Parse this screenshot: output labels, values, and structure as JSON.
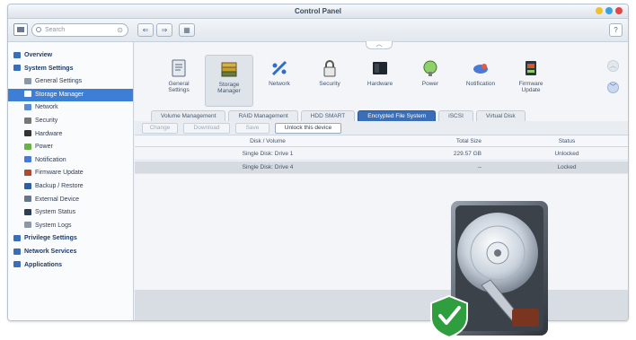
{
  "window": {
    "title": "Control Panel"
  },
  "toolbar": {
    "search_placeholder": "Search",
    "back": "⇐",
    "forward": "⇒",
    "grid": "▦",
    "help": "?"
  },
  "sidebar": {
    "items": [
      {
        "label": "Overview",
        "level": "top",
        "icon": "overview-icon",
        "color": "#3a6fb8"
      },
      {
        "label": "System Settings",
        "level": "top",
        "icon": "gear-icon",
        "color": "#3a6fb8"
      },
      {
        "label": "General Settings",
        "level": "sub",
        "icon": "general-settings-icon",
        "color": "#8899aa"
      },
      {
        "label": "Storage Manager",
        "level": "sub",
        "icon": "storage-icon",
        "color": "#c8a040",
        "active": true
      },
      {
        "label": "Network",
        "level": "sub",
        "icon": "network-icon",
        "color": "#5a8ad0"
      },
      {
        "label": "Security",
        "level": "sub",
        "icon": "lock-icon",
        "color": "#777777"
      },
      {
        "label": "Hardware",
        "level": "sub",
        "icon": "hardware-icon",
        "color": "#333333"
      },
      {
        "label": "Power",
        "level": "sub",
        "icon": "power-icon",
        "color": "#6ab04c"
      },
      {
        "label": "Notification",
        "level": "sub",
        "icon": "notification-icon",
        "color": "#4a7ad8"
      },
      {
        "label": "Firmware Update",
        "level": "sub",
        "icon": "firmware-icon",
        "color": "#b04a30"
      },
      {
        "label": "Backup / Restore",
        "level": "sub",
        "icon": "backup-icon",
        "color": "#2f5e9e"
      },
      {
        "label": "External Device",
        "level": "sub",
        "icon": "external-device-icon",
        "color": "#667788"
      },
      {
        "label": "System Status",
        "level": "sub",
        "icon": "system-status-icon",
        "color": "#2c3e55"
      },
      {
        "label": "System Logs",
        "level": "sub",
        "icon": "logs-icon",
        "color": "#8899aa"
      },
      {
        "label": "Privilege Settings",
        "level": "top",
        "icon": "user-icon",
        "color": "#3a6fb8"
      },
      {
        "label": "Network Services",
        "level": "top",
        "icon": "globe-icon",
        "color": "#3a6fb8"
      },
      {
        "label": "Applications",
        "level": "top",
        "icon": "apps-icon",
        "color": "#3a6fb8"
      }
    ]
  },
  "apps": [
    {
      "label_line1": "General",
      "label_line2": "Settings",
      "icon": "general-settings-icon"
    },
    {
      "label_line1": "Storage",
      "label_line2": "Manager",
      "icon": "storage-icon",
      "active": true
    },
    {
      "label_line1": "Network",
      "label_line2": "",
      "icon": "network-icon"
    },
    {
      "label_line1": "Security",
      "label_line2": "",
      "icon": "lock-icon"
    },
    {
      "label_line1": "Hardware",
      "label_line2": "",
      "icon": "hardware-icon"
    },
    {
      "label_line1": "Power",
      "label_line2": "",
      "icon": "power-icon"
    },
    {
      "label_line1": "Notification",
      "label_line2": "",
      "icon": "notification-icon"
    },
    {
      "label_line1": "Firmware",
      "label_line2": "Update",
      "icon": "firmware-icon"
    }
  ],
  "tabs": [
    {
      "label": "Volume Management"
    },
    {
      "label": "RAID Management"
    },
    {
      "label": "HDD SMART"
    },
    {
      "label": "Encrypted File System",
      "active": true
    },
    {
      "label": "iSCSI"
    },
    {
      "label": "Virtual Disk"
    }
  ],
  "actions": {
    "change": "Change",
    "download": "Download",
    "save": "Save",
    "unlock": "Unlock this device"
  },
  "table": {
    "headers": {
      "disk_volume": "Disk / Volume",
      "total_size": "Total Size",
      "status": "Status"
    },
    "rows": [
      {
        "disk_volume": "Single Disk: Drive 1",
        "total_size": "229.57 GB",
        "status": "Unlocked"
      },
      {
        "disk_volume": "Single Disk: Drive 4",
        "total_size": "--",
        "status": "Locked",
        "selected": true
      }
    ]
  },
  "colors": {
    "accent": "#3d7fd6",
    "shield": "#2e9e3e"
  }
}
